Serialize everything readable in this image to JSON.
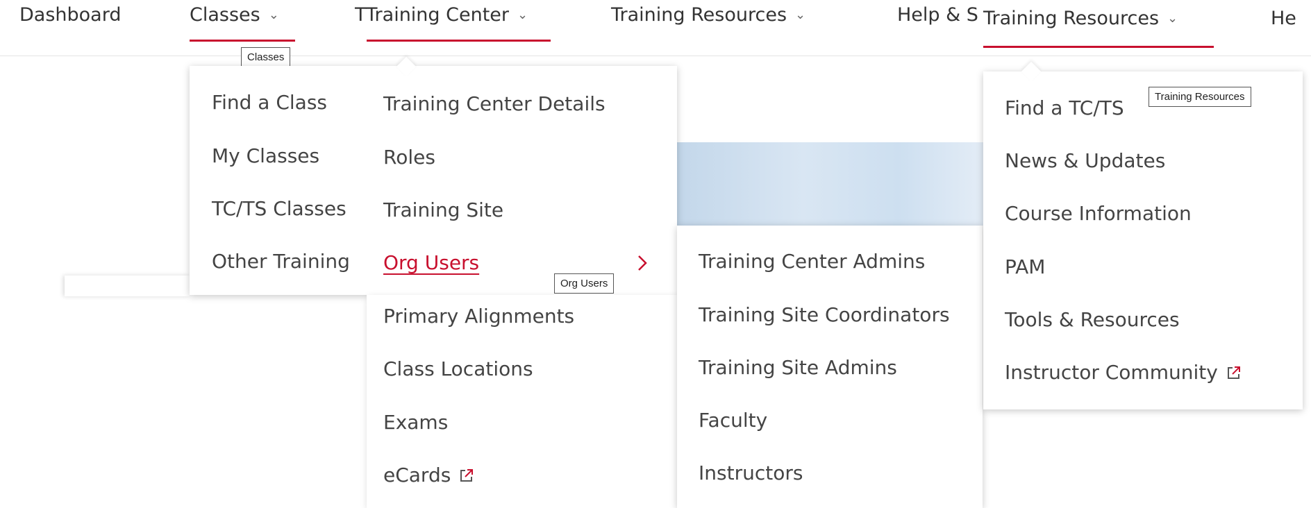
{
  "nav": {
    "dashboard": "Dashboard",
    "classes": "Classes",
    "training_center": "TTraining Center",
    "training_resources": "Training Resources",
    "help_truncated": "Help & S",
    "training_resources_2": "Training Resources",
    "help_truncated_2": "He"
  },
  "tooltips": {
    "classes": "Classes",
    "org_users": "Org Users",
    "training_resources": "Training Resources"
  },
  "classes_menu": [
    "Find a Class",
    "My Classes",
    "TC/TS Classes",
    "Other Training"
  ],
  "training_center_menu": [
    "Training Center Details",
    "Roles",
    "Training Site",
    "Org Users",
    "Primary Alignments",
    "Class Locations",
    "Exams",
    "eCards"
  ],
  "org_users_menu": [
    "Training Center Admins",
    "Training Site Coordinators",
    "Training Site Admins",
    "Faculty",
    "Instructors"
  ],
  "training_resources_menu": [
    "Find a TC/TS",
    "News & Updates",
    "Course Information",
    "PAM",
    "Tools & Resources",
    "Instructor Community"
  ],
  "icons": {
    "chevron": "chevron-down-icon",
    "chevron_right": "chevron-right-icon",
    "external": "external-link-icon"
  },
  "colors": {
    "accent": "#c8102e",
    "text": "#3a3a3a"
  }
}
